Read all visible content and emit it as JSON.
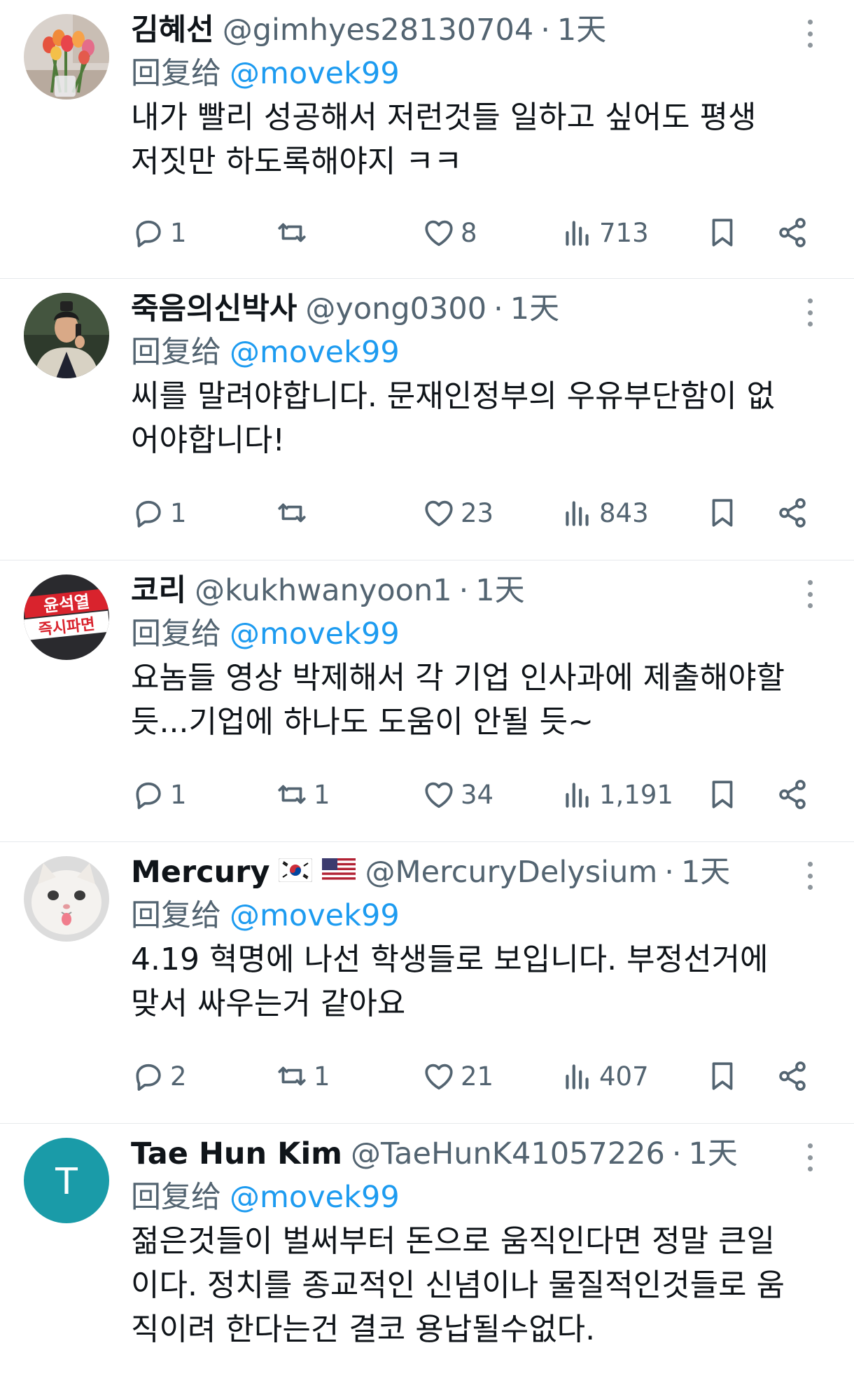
{
  "reply_prefix": "回复给",
  "tweets": [
    {
      "name": "김혜선",
      "flags": [],
      "handle": "@gimhyes28130704",
      "time": "1天",
      "reply_to": "@movek99",
      "text": "내가 빨리 성공해서 저런것들 일하고 싶어도 평생\n저짓만 하도록해야지 ㅋㅋ",
      "replies": "1",
      "retweets": "",
      "likes": "8",
      "views": "713",
      "avatar": {
        "type": "photo",
        "icon": "tulips-photo"
      }
    },
    {
      "name": "죽음의신박사",
      "flags": [],
      "handle": "@yong0300",
      "time": "1天",
      "reply_to": "@movek99",
      "text": "씨를 말려야합니다. 문재인정부의 우유부단함이 없\n어야합니다!",
      "replies": "1",
      "retweets": "",
      "likes": "23",
      "views": "843",
      "avatar": {
        "type": "photo",
        "icon": "person-phone-photo"
      }
    },
    {
      "name": "코리",
      "flags": [],
      "handle": "@kukhwanyoon1",
      "time": "1天",
      "reply_to": "@movek99",
      "text": "요놈들 영상 박제해서 각 기업 인사과에 제출해야할\n듯...기업에 하나도 도움이 안될 듯~",
      "replies": "1",
      "retweets": "1",
      "likes": "34",
      "views": "1,191",
      "avatar": {
        "type": "badge",
        "icon": "protest-sign-photo",
        "lines": [
          "윤석열",
          "즉시파면"
        ]
      }
    },
    {
      "name": "Mercury",
      "flags": [
        "🇰🇷",
        "🇺🇸"
      ],
      "handle": "@MercuryDelysium",
      "time": "1天",
      "reply_to": "@movek99",
      "text": "4.19 혁명에 나선 학생들로 보입니다. 부정선거에\n맞서 싸우는거 같아요",
      "replies": "2",
      "retweets": "1",
      "likes": "21",
      "views": "407",
      "avatar": {
        "type": "photo",
        "icon": "white-cat-photo"
      }
    },
    {
      "name": "Tae Hun Kim",
      "flags": [],
      "handle": "@TaeHunK41057226",
      "time": "1天",
      "reply_to": "@movek99",
      "text": "젊은것들이 벌써부터 돈으로 움직인다면 정말 큰일\n이다. 정치를 종교적인 신념이나 물질적인것들로 움\n직이려 한다는건 결코 용납될수없다.",
      "replies": "",
      "retweets": "",
      "likes": "",
      "views": "",
      "avatar": {
        "type": "letter",
        "icon": "letter-avatar",
        "letter": "T",
        "color": "#1a9ba8"
      }
    }
  ],
  "colors": {
    "text": "#0f1419",
    "secondary": "#536471",
    "link": "#1d9bf0",
    "divider": "#e6e9ec"
  }
}
